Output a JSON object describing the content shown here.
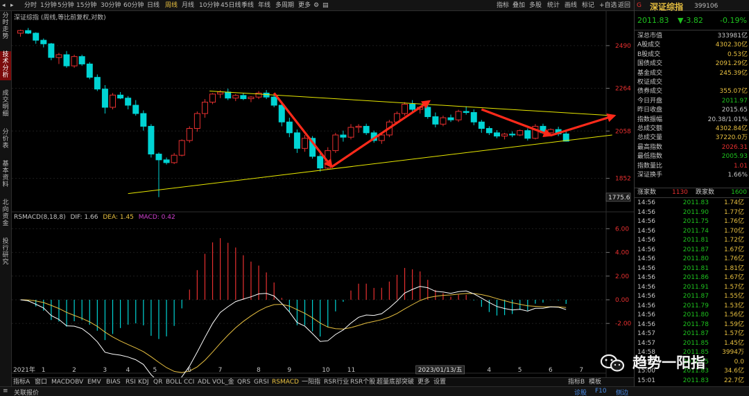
{
  "toolbar": {
    "periods": [
      "分时",
      "1分钟",
      "5分钟",
      "15分钟",
      "30分钟",
      "60分钟",
      "日线",
      "周线",
      "月线",
      "10分钟",
      "45日线",
      "季线",
      "年线",
      "多周期",
      "更多"
    ],
    "active_period": "周线",
    "right_buttons": [
      "指标",
      "叠加",
      "多股",
      "统计",
      "画线",
      "标记",
      "+自选",
      "返回"
    ]
  },
  "left_tabs": [
    "分时走势",
    "技术分析",
    "成交明细",
    "分价表",
    "基本资料",
    "北向资金",
    "投行研究"
  ],
  "active_left_tab": "技术分析",
  "chart": {
    "title": "深证综指 (周线,等比前复权,对数)",
    "y_labels": [
      "2490",
      "2264",
      "2058",
      "1852"
    ],
    "low_marker": "1775.6"
  },
  "indicator": {
    "name": "RSMACD(8,18,8)",
    "dif_label": "DIF: 1.66",
    "dea_label": "DEA: 1.45",
    "macd_label": "MACD: 0.42",
    "y_labels": [
      "6.00",
      "4.00",
      "2.00",
      "0.00",
      "-2.00"
    ]
  },
  "x_axis": {
    "year_label": "2021年",
    "months": [
      "1",
      "2",
      "3",
      "4",
      "5",
      "6",
      "7",
      "8",
      "9",
      "10",
      "11",
      "1",
      "3",
      "4",
      "5",
      "6",
      "7"
    ],
    "date_box": "2023/01/13/五"
  },
  "bottom_tabs": [
    "指标A",
    "窗口",
    "MACD",
    "OBV",
    "EMV",
    "BIAS",
    "RSI",
    "KDJ",
    "QR",
    "BOLL",
    "CCI",
    "ADL",
    "VOL_金",
    "QRS",
    "GRSI",
    "RSMACD",
    "一阳指",
    "RSR行业",
    "RSR个股",
    "超量底部突破",
    "更多",
    "设置"
  ],
  "active_bottom_tab": "RSMACD",
  "bottom_right": [
    "指标B",
    "模板"
  ],
  "status": {
    "left": "关联报价",
    "right": [
      "诊股",
      "F10",
      "侧边"
    ]
  },
  "quote": {
    "indicator": "G",
    "name": "深证综指",
    "code": "399106",
    "price": "2011.83",
    "change": "▼-3.82",
    "pct": "-0.19%",
    "stats": [
      {
        "label": "深总市值",
        "value": "333981亿",
        "color": "#c8c8c8"
      },
      {
        "label": "A股成交",
        "value": "4302.30亿",
        "color": "#e8c040"
      },
      {
        "label": "B股成交",
        "value": "0.53亿",
        "color": "#e8c040"
      },
      {
        "label": "国债成交",
        "value": "2091.29亿",
        "color": "#e8c040"
      },
      {
        "label": "基金成交",
        "value": "245.39亿",
        "color": "#e8c040"
      },
      {
        "label": "权证成交",
        "value": "",
        "color": "#e8c040"
      },
      {
        "label": "债券成交",
        "value": "355.07亿",
        "color": "#e8c040"
      },
      {
        "label": "今日开盘",
        "value": "2011.97",
        "color": "#1ec31e"
      },
      {
        "label": "昨日收盘",
        "value": "2015.65",
        "color": "#c8c8c8"
      },
      {
        "label": "指数振幅",
        "value": "20.38/1.01%",
        "color": "#c8c8c8"
      },
      {
        "label": "总成交额",
        "value": "4302.84亿",
        "color": "#e8c040"
      },
      {
        "label": "总成交量",
        "value": "37220.0万",
        "color": "#e8c040"
      },
      {
        "label": "最高指数",
        "value": "2026.31",
        "color": "#e83030"
      },
      {
        "label": "最低指数",
        "value": "2005.93",
        "color": "#1ec31e"
      },
      {
        "label": "指数量比",
        "value": "1.01",
        "color": "#e83030"
      },
      {
        "label": "深证换手",
        "value": "1.66%",
        "color": "#c8c8c8"
      }
    ],
    "rise_label": "涨家数",
    "rise": "1130",
    "fall_label": "跌家数",
    "fall": "1600"
  },
  "ticks": [
    {
      "time": "14:56",
      "price": "2011.83",
      "vol": "1.74亿"
    },
    {
      "time": "14:56",
      "price": "2011.90",
      "vol": "1.77亿"
    },
    {
      "time": "14:56",
      "price": "2011.75",
      "vol": "1.76亿"
    },
    {
      "time": "14:56",
      "price": "2011.74",
      "vol": "1.70亿"
    },
    {
      "time": "14:56",
      "price": "2011.81",
      "vol": "1.72亿"
    },
    {
      "time": "14:56",
      "price": "2011.87",
      "vol": "1.67亿"
    },
    {
      "time": "14:56",
      "price": "2011.80",
      "vol": "1.76亿"
    },
    {
      "time": "14:56",
      "price": "2011.81",
      "vol": "1.81亿"
    },
    {
      "time": "14:56",
      "price": "2011.86",
      "vol": "1.67亿"
    },
    {
      "time": "14:56",
      "price": "2011.91",
      "vol": "1.57亿"
    },
    {
      "time": "14:56",
      "price": "2011.87",
      "vol": "1.55亿"
    },
    {
      "time": "14:56",
      "price": "2011.79",
      "vol": "1.53亿"
    },
    {
      "time": "14:56",
      "price": "2011.80",
      "vol": "1.56亿"
    },
    {
      "time": "14:56",
      "price": "2011.78",
      "vol": "1.59亿"
    },
    {
      "time": "14:57",
      "price": "2011.87",
      "vol": "1.57亿"
    },
    {
      "time": "14:57",
      "price": "2011.85",
      "vol": "1.45亿"
    },
    {
      "time": "14:58",
      "price": "2011.85",
      "vol": "3994万"
    },
    {
      "time": "14:59",
      "price": "2011.85",
      "vol": "0.0"
    },
    {
      "time": "15:00",
      "price": "2011.83",
      "vol": "34.6亿"
    },
    {
      "time": "15:01",
      "price": "2011.83",
      "vol": "22.7亿"
    }
  ],
  "watermark": "趋势一阳指",
  "colors": {
    "up": "#e83030",
    "down": "#00d4d4",
    "trend": "#e8e800",
    "arrow": "#ff2a1a",
    "dif": "#ffffff",
    "dea": "#e8c040"
  },
  "chart_data": {
    "type": "candlestick",
    "title": "深证综指 (周线,等比前复权,对数)",
    "y_ticks": [
      2490,
      2264,
      2058,
      1852
    ],
    "low": 1775.6,
    "candles": [
      [
        2560,
        2580,
        2540,
        2575
      ],
      [
        2575,
        2590,
        2555,
        2560
      ],
      [
        2560,
        2565,
        2500,
        2520
      ],
      [
        2520,
        2530,
        2480,
        2500
      ],
      [
        2500,
        2505,
        2410,
        2425
      ],
      [
        2425,
        2450,
        2390,
        2440
      ],
      [
        2440,
        2460,
        2370,
        2380
      ],
      [
        2380,
        2440,
        2370,
        2430
      ],
      [
        2430,
        2440,
        2380,
        2390
      ],
      [
        2390,
        2400,
        2310,
        2320
      ],
      [
        2320,
        2335,
        2250,
        2260
      ],
      [
        2260,
        2280,
        2140,
        2170
      ],
      [
        2170,
        2240,
        2160,
        2230
      ],
      [
        2230,
        2245,
        2210,
        2215
      ],
      [
        2215,
        2225,
        2160,
        2180
      ],
      [
        2180,
        2205,
        2130,
        2140
      ],
      [
        2140,
        2155,
        2060,
        2080
      ],
      [
        2080,
        2090,
        1940,
        1955
      ],
      [
        1955,
        1962,
        1776,
        1930
      ],
      [
        1930,
        1940,
        1910,
        1918
      ],
      [
        1918,
        1960,
        1912,
        1950
      ],
      [
        1950,
        2020,
        1945,
        2015
      ],
      [
        2015,
        2080,
        2005,
        2070
      ],
      [
        2070,
        2150,
        2055,
        2140
      ],
      [
        2140,
        2210,
        2120,
        2195
      ],
      [
        2195,
        2240,
        2185,
        2235
      ],
      [
        2235,
        2255,
        2215,
        2245
      ],
      [
        2245,
        2262,
        2205,
        2215
      ],
      [
        2215,
        2235,
        2200,
        2228
      ],
      [
        2228,
        2240,
        2205,
        2212
      ],
      [
        2212,
        2225,
        2195,
        2220
      ],
      [
        2220,
        2250,
        2210,
        2240
      ],
      [
        2240,
        2255,
        2210,
        2220
      ],
      [
        2220,
        2235,
        2170,
        2180
      ],
      [
        2180,
        2190,
        2080,
        2100
      ],
      [
        2100,
        2120,
        2030,
        2050
      ],
      [
        2050,
        2065,
        1960,
        1980
      ],
      [
        1980,
        2040,
        1965,
        2025
      ],
      [
        2025,
        2035,
        1935,
        1945
      ],
      [
        1945,
        1960,
        1880,
        1895
      ],
      [
        1895,
        1985,
        1890,
        1970
      ],
      [
        1970,
        2050,
        1960,
        2040
      ],
      [
        2040,
        2060,
        2010,
        2030
      ],
      [
        2030,
        2090,
        2020,
        2075
      ],
      [
        2075,
        2090,
        2050,
        2080
      ],
      [
        2080,
        2092,
        2040,
        2050
      ],
      [
        2050,
        2060,
        2005,
        2015
      ],
      [
        2015,
        2050,
        2000,
        2040
      ],
      [
        2040,
        2110,
        2030,
        2100
      ],
      [
        2100,
        2150,
        2090,
        2140
      ],
      [
        2140,
        2195,
        2130,
        2185
      ],
      [
        2185,
        2205,
        2150,
        2160
      ],
      [
        2160,
        2175,
        2140,
        2170
      ],
      [
        2170,
        2180,
        2115,
        2125
      ],
      [
        2125,
        2145,
        2075,
        2090
      ],
      [
        2090,
        2130,
        2080,
        2120
      ],
      [
        2120,
        2135,
        2100,
        2110
      ],
      [
        2110,
        2158,
        2100,
        2150
      ],
      [
        2150,
        2175,
        2135,
        2145
      ],
      [
        2145,
        2160,
        2085,
        2100
      ],
      [
        2100,
        2110,
        2050,
        2070
      ],
      [
        2070,
        2080,
        2040,
        2050
      ],
      [
        2050,
        2062,
        2025,
        2035
      ],
      [
        2035,
        2050,
        2020,
        2044
      ],
      [
        2044,
        2056,
        2030,
        2040
      ],
      [
        2040,
        2065,
        2035,
        2060
      ],
      [
        2060,
        2070,
        2015,
        2025
      ],
      [
        2025,
        2090,
        2020,
        2080
      ],
      [
        2080,
        2092,
        2045,
        2050
      ],
      [
        2050,
        2070,
        2040,
        2065
      ],
      [
        2065,
        2078,
        2035,
        2045
      ],
      [
        2045,
        2056,
        2010,
        2012
      ]
    ]
  }
}
